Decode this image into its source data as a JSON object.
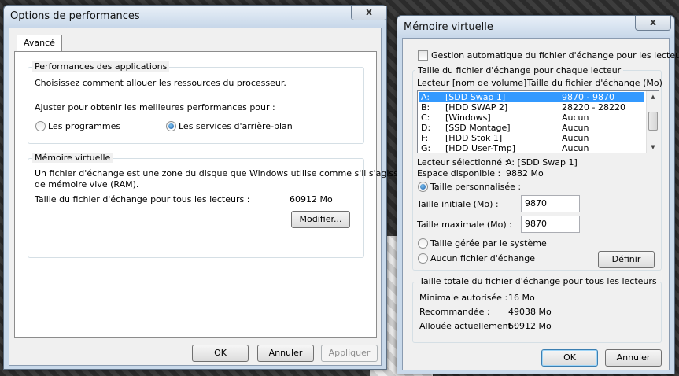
{
  "perf_window": {
    "title": "Options de performances",
    "close_glyph": "x",
    "tab_label": "Avancé",
    "apps_group": {
      "label": "Performances des applications",
      "desc": "Choisissez comment allouer les ressources du processeur.",
      "adjust": "Ajuster pour obtenir les meilleures performances pour :",
      "option_programs": "Les programmes",
      "option_services": "Les services d'arrière-plan",
      "selected": "services"
    },
    "vm_group": {
      "label": "Mémoire virtuelle",
      "desc_line1": "Un fichier d'échange est une zone du disque que Windows utilise comme s'il s'agissait",
      "desc_line2": "de mémoire vive (RAM).",
      "size_label": "Taille du fichier d'échange pour tous les lecteurs :",
      "size_value": "60912 Mo",
      "modify_button": "Modifier..."
    },
    "buttons": {
      "ok": "OK",
      "cancel": "Annuler",
      "apply": "Appliquer"
    }
  },
  "vm_window": {
    "title": "Mémoire virtuelle",
    "close_glyph": "x",
    "auto_manage_label": "Gestion automatique du fichier d'échange pour les lecteurs",
    "auto_manage_checked": false,
    "drives_group_label": "Taille du fichier d'échange pour chaque lecteur",
    "col_drive": "Lecteur [nom de volume]",
    "col_size": "Taille du fichier d'échange (Mo)",
    "drives": [
      {
        "letter": "A:",
        "name": "[SDD Swap 1]",
        "size": "9870 - 9870",
        "selected": true
      },
      {
        "letter": "B:",
        "name": "[HDD SWAP 2]",
        "size": "28220 - 28220",
        "selected": false
      },
      {
        "letter": "C:",
        "name": "[Windows]",
        "size": "Aucun",
        "selected": false
      },
      {
        "letter": "D:",
        "name": "[SSD Montage]",
        "size": "Aucun",
        "selected": false
      },
      {
        "letter": "F:",
        "name": "[HDD Stok 1]",
        "size": "Aucun",
        "selected": false
      },
      {
        "letter": "G:",
        "name": "[HDD User-Tmp]",
        "size": "Aucun",
        "selected": false
      }
    ],
    "selected_drive_label": "Lecteur sélectionné :",
    "selected_drive_value": "A:  [SDD Swap 1]",
    "free_space_label": "Espace disponible :",
    "free_space_value": "9882 Mo",
    "custom_size_label": "Taille personnalisée :",
    "initial_size_label": "Taille initiale (Mo) :",
    "initial_size_value": "9870",
    "max_size_label": "Taille maximale (Mo) :",
    "max_size_value": "9870",
    "system_managed_label": "Taille gérée par le système",
    "no_paging_label": "Aucun fichier d'échange",
    "set_button": "Définir",
    "size_mode": "custom",
    "total_group_label": "Taille totale du fichier d'échange pour tous les lecteurs",
    "min_label": "Minimale autorisée :",
    "min_value": "16 Mo",
    "recommended_label": "Recommandée :",
    "recommended_value": "49038 Mo",
    "current_label": "Allouée actuellement :",
    "current_value": "60912 Mo",
    "buttons": {
      "ok": "OK",
      "cancel": "Annuler"
    }
  }
}
